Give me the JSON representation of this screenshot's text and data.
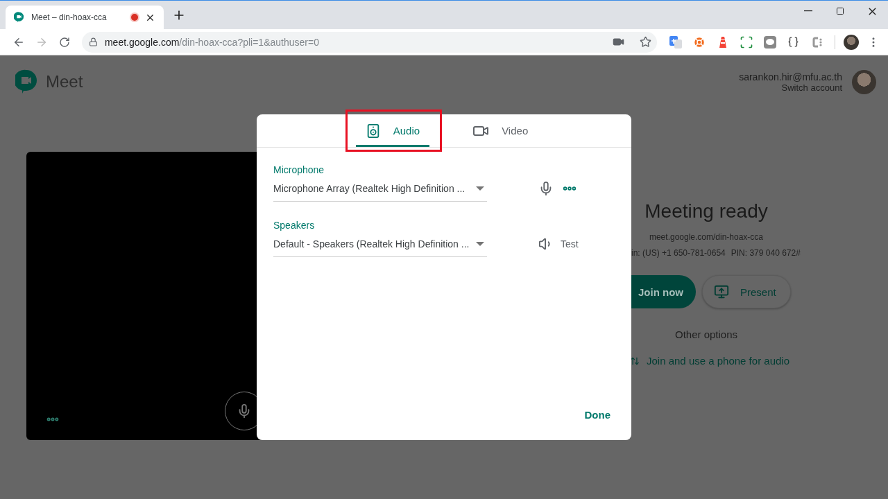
{
  "browser": {
    "tab": {
      "title": "Meet – din-hoax-cca",
      "recording": true
    },
    "address": {
      "host": "meet.google.com",
      "path": "/din-hoax-cca?pli=1&authuser=0"
    }
  },
  "app": {
    "name": "Meet"
  },
  "account": {
    "email": "sarankon.hir@mfu.ac.th",
    "switch": "Switch account"
  },
  "meeting": {
    "title": "Meeting ready",
    "link": "meet.google.com/din-hoax-cca",
    "dial_in": "in: (US) +1 650-781-0654",
    "pin": "PIN: 379 040 672#",
    "join": "Join now",
    "present": "Present",
    "other_options": "Other options",
    "phone_audio": "Join and use a phone for audio"
  },
  "dialog": {
    "tabs": [
      {
        "label": "Audio",
        "selected": true,
        "kind": "speaker"
      },
      {
        "label": "Video",
        "selected": false,
        "kind": "camera"
      }
    ],
    "devices": [
      {
        "label": "Microphone",
        "value": "Microphone Array (Realtek High Definition ...",
        "kind": "microphone"
      },
      {
        "label": "Speakers",
        "value": "Default - Speakers (Realtek High Definition ...",
        "kind": "speakers",
        "action": "Test"
      }
    ],
    "done": "Done"
  }
}
